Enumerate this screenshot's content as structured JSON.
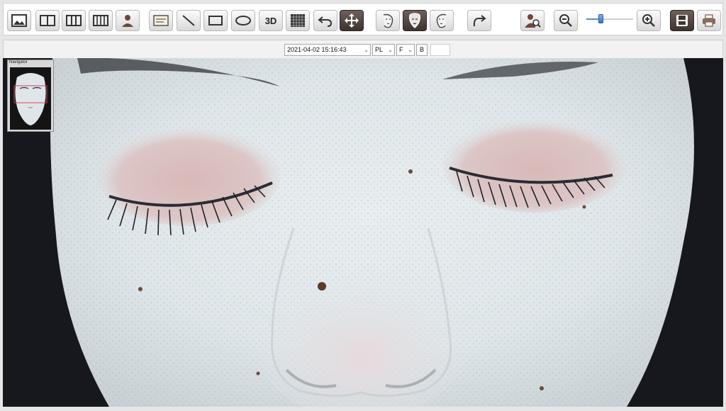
{
  "toolbar": {
    "buttons": [
      {
        "name": "single-view",
        "icon": "single-image-icon"
      },
      {
        "name": "dual-view",
        "icon": "two-column-icon"
      },
      {
        "name": "triple-view",
        "icon": "three-column-icon"
      },
      {
        "name": "quad-view",
        "icon": "four-column-icon"
      },
      {
        "name": "patient",
        "icon": "person-icon"
      },
      {
        "name": "annotation",
        "icon": "text-box-icon"
      },
      {
        "name": "line-tool",
        "icon": "line-icon"
      },
      {
        "name": "rectangle-tool",
        "icon": "rectangle-icon"
      },
      {
        "name": "ellipse-tool",
        "icon": "ellipse-icon"
      },
      {
        "name": "3d-view",
        "label": "3D"
      },
      {
        "name": "grid-view",
        "icon": "grid-icon"
      },
      {
        "name": "undo",
        "icon": "undo-icon"
      },
      {
        "name": "pan",
        "icon": "move-icon"
      },
      {
        "name": "face-left",
        "icon": "face-left-icon"
      },
      {
        "name": "face-front",
        "icon": "face-front-icon"
      },
      {
        "name": "face-right",
        "icon": "face-right-icon"
      },
      {
        "name": "redo",
        "icon": "redo-icon"
      },
      {
        "name": "search-patient",
        "icon": "person-search-icon"
      },
      {
        "name": "zoom-out",
        "icon": "zoom-out-icon"
      },
      {
        "name": "zoom-in",
        "icon": "zoom-in-icon"
      },
      {
        "name": "save",
        "icon": "save-icon"
      },
      {
        "name": "print",
        "icon": "print-icon"
      }
    ],
    "label_3d": "3D",
    "zoom_level": 0.3
  },
  "infobar": {
    "datetime": "2021-04-02 15:16:43",
    "light_mode": "PL",
    "view_mode": "F",
    "b_label": "B",
    "dropdown_arrow": "⌄"
  },
  "navigator": {
    "title": "Navigator"
  },
  "colors": {
    "accent": "#5a8fd8",
    "active_button": "#4a3d38",
    "viewport_frame": "#d9405a"
  }
}
